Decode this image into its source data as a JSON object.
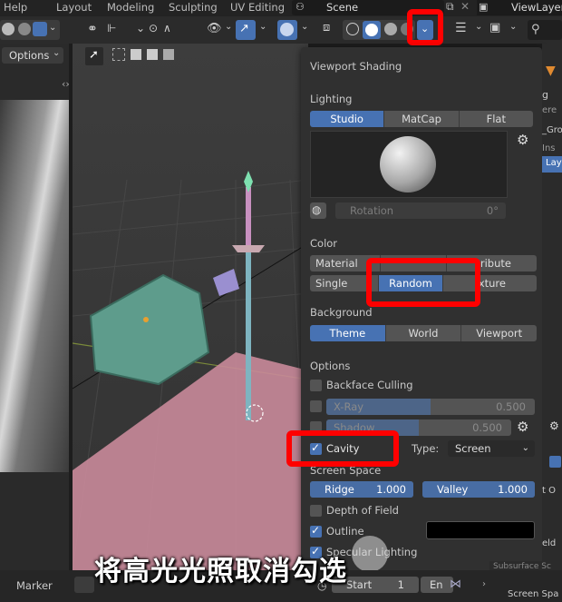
{
  "top_menu": {
    "help": "Help",
    "layout": "Layout",
    "modeling": "Modeling",
    "sculpting": "Sculpting",
    "uv_editing": "UV Editing",
    "scene": "Scene",
    "view_layer": "ViewLayer"
  },
  "left_panel": {
    "options_label": "Options"
  },
  "shading_panel": {
    "title": "Viewport Shading",
    "lighting": {
      "label": "Lighting",
      "options": [
        "Studio",
        "MatCap",
        "Flat"
      ],
      "active": "Studio",
      "rotation_label": "Rotation",
      "rotation_value": "0°"
    },
    "color": {
      "label": "Color",
      "row1": [
        "Material",
        "",
        "Attribute"
      ],
      "row1_visible": [
        "Material",
        "ribute"
      ],
      "row2": [
        "Single",
        "Random",
        "Texture"
      ],
      "row2_visible": [
        "Single",
        "Random",
        "xture"
      ],
      "active": "Random"
    },
    "background": {
      "label": "Background",
      "options": [
        "Theme",
        "World",
        "Viewport"
      ],
      "active": "Theme"
    },
    "options": {
      "label": "Options",
      "backface_culling": "Backface Culling",
      "xray": "X-Ray",
      "xray_value": "0.500",
      "shadow": "Shadow",
      "shadow_value": "0.500",
      "cavity": "Cavity",
      "type_label": "Type:",
      "type_value": "Screen",
      "screen_space": "Screen Space",
      "ridge": "Ridge",
      "ridge_value": "1.000",
      "valley": "Valley",
      "valley_value": "1.000",
      "depth_of_field": "Depth of Field",
      "outline": "Outline",
      "specular_lighting": "Specular Lighting"
    }
  },
  "right_side": {
    "g_label": "g",
    "ere": "ere",
    "gro": "_Gro",
    "ins": "Ins",
    "lay": "Lay",
    "t_o": "t O",
    "eld": "eld",
    "screen_spa": "Screen Spa",
    "subsurface": "Subsurface Sc"
  },
  "bottom": {
    "marker": "Marker",
    "start_label": "Start",
    "start_value": "1",
    "end_label": "En"
  },
  "subtitle": "将高光光照取消勾选",
  "colors": {
    "accent_blue": "#4772b3",
    "highlight_red": "#ff0000",
    "panel_bg": "#303030"
  }
}
